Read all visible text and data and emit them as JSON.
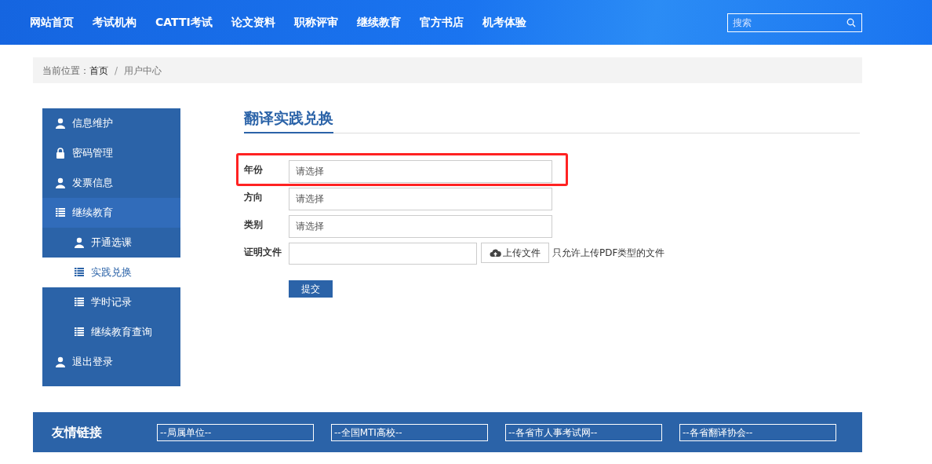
{
  "nav": {
    "items": [
      "网站首页",
      "考试机构",
      "CATTI考试",
      "论文资料",
      "职称评审",
      "继续教育",
      "官方书店",
      "机考体验"
    ],
    "search": {
      "placeholder": "搜索"
    }
  },
  "breadcrumb": {
    "prefix": "当前位置：",
    "separator": "/",
    "items": [
      {
        "label": "首页",
        "selected": false
      },
      {
        "label": "用户中心",
        "selected": true
      }
    ]
  },
  "sidebar": {
    "items": [
      {
        "label": "信息维护",
        "kind": "user",
        "selected": false
      },
      {
        "label": "密码管理",
        "kind": "lock",
        "selected": false
      },
      {
        "label": "发票信息",
        "kind": "user",
        "selected": false
      },
      {
        "label": "继续教育",
        "kind": "list",
        "selected": false,
        "expanded": true,
        "children": [
          {
            "label": "开通选课",
            "kind": "user",
            "selected": false
          },
          {
            "label": "实践兑换",
            "kind": "list",
            "selected": true
          },
          {
            "label": "学时记录",
            "kind": "list",
            "selected": false
          },
          {
            "label": "继续教育查询",
            "kind": "list",
            "selected": false
          }
        ]
      },
      {
        "label": "退出登录",
        "kind": "user",
        "selected": false
      }
    ]
  },
  "form": {
    "title": "翻译实践兑换",
    "fields": [
      {
        "label": "年份",
        "kind": "select",
        "placeholder": "请选择",
        "highlighted": true
      },
      {
        "label": "方向",
        "kind": "select",
        "placeholder": "请选择",
        "highlighted": false
      },
      {
        "label": "类别",
        "kind": "select",
        "placeholder": "请选择",
        "highlighted": false
      },
      {
        "label": "证明文件",
        "kind": "file",
        "button": "上传文件",
        "hint": "只允许上传PDF类型的文件",
        "highlighted": false
      }
    ],
    "submit": "提交"
  },
  "footer": {
    "title": "友情链接",
    "links": [
      "--局属单位--",
      "--全国MTI高校--",
      "--各省市人事考试网--",
      "--各省翻译协会--"
    ]
  }
}
